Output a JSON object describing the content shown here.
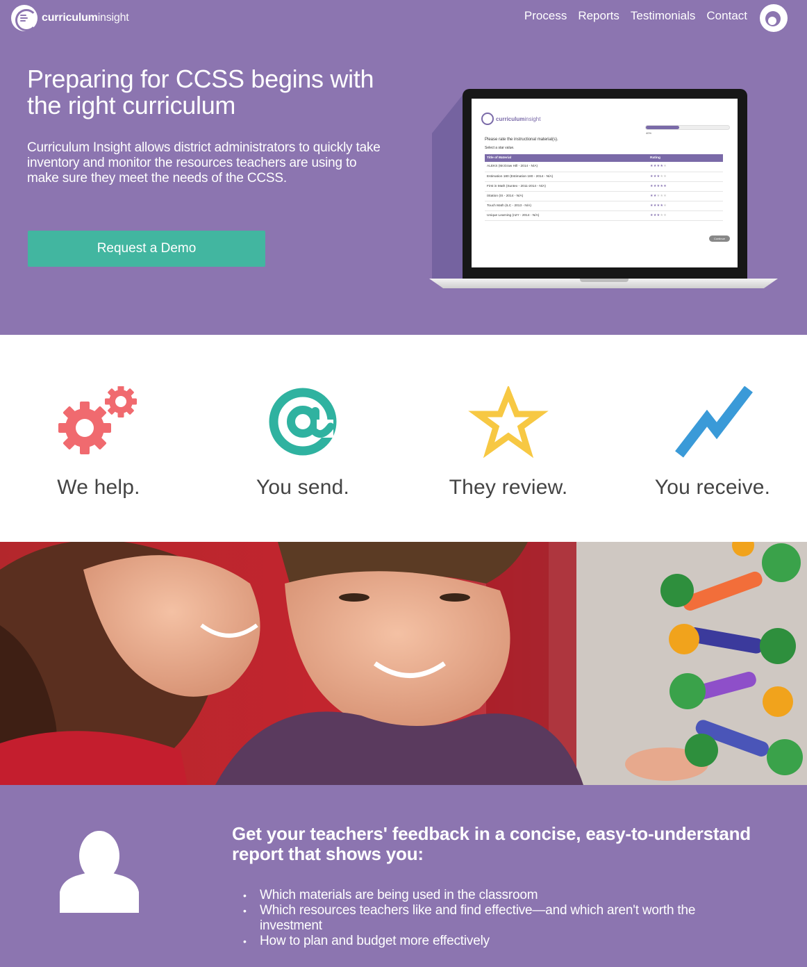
{
  "header": {
    "logo_bold": "curriculum",
    "logo_light": "insight",
    "nav": [
      "Process",
      "Reports",
      "Testimonials",
      "Contact"
    ]
  },
  "hero": {
    "title": "Preparing for CCSS begins with the right curriculum",
    "description": "Curriculum Insight allows district administrators to quickly take inventory and monitor the resources teachers are using to make sure they meet the needs of the CCSS.",
    "cta": "Request a Demo"
  },
  "screen": {
    "logo_bold": "curriculum",
    "logo_light": "insight",
    "progress": 0.4,
    "progress_label": "40%",
    "question": "Please rate the instructional material(s).",
    "sub": "Select a star value.",
    "columns": [
      "Title of Material",
      "Rating"
    ],
    "rows": [
      {
        "title": "ALEKS (McGraw Hill - 2014 - N/A)",
        "rating": 4
      },
      {
        "title": "Estimation 180 (Estimation 180 - 2014 - N/A)",
        "rating": 3
      },
      {
        "title": "First in Math (Suntex - 2011-2014 - N/A)",
        "rating": 5
      },
      {
        "title": "iStation (IS - 2014 - N/A)",
        "rating": 2
      },
      {
        "title": "Touch Math (ILC - 2013 - N/A)",
        "rating": 4
      },
      {
        "title": "Unique Learning (n2Y - 2014 - N/A)",
        "rating": 3
      }
    ],
    "continue": "Continue"
  },
  "steps": [
    {
      "label": "We help.",
      "icon": "gears-icon",
      "color": "#f06a6f"
    },
    {
      "label": "You send.",
      "icon": "at-sign-icon",
      "color": "#2fb2a0"
    },
    {
      "label": "They review.",
      "icon": "star-icon",
      "color": "#f7c843"
    },
    {
      "label": "You receive.",
      "icon": "trend-line-icon",
      "color": "#3a9ad8"
    }
  ],
  "report": {
    "title": "Get your teachers' feedback in a concise, easy-to-understand report that shows you:",
    "items": [
      "Which materials are being used in the classroom",
      "Which resources teachers like and find effective—and which aren't worth the investment",
      "How to plan and budget more effectively"
    ]
  },
  "colors": {
    "purple": "#8c75b0",
    "teal_button": "#42b6a0"
  }
}
